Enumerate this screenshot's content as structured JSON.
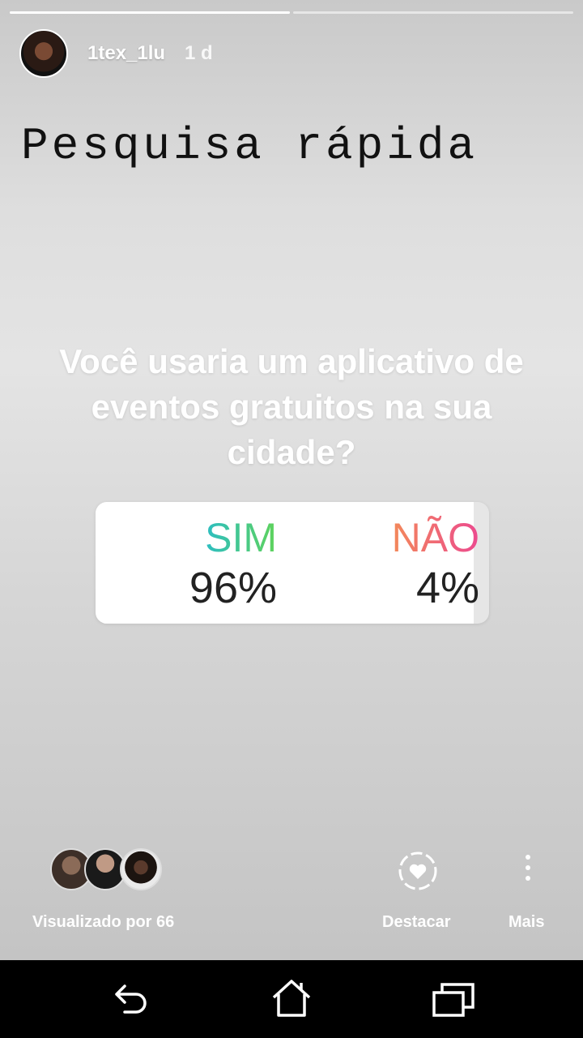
{
  "story": {
    "progress": [
      1.0,
      0.0
    ],
    "username": "1tex_1lu",
    "time_ago": "1 d",
    "headline": "Pesquisa rápida",
    "question": "Você usaria um aplicativo de eventos gratuitos na sua cidade?",
    "poll": {
      "yes_label": "SIM",
      "yes_percent": "96%",
      "no_label": "NÃO",
      "no_percent": "4%",
      "yes_fraction": 0.96
    }
  },
  "footer": {
    "viewed_by": "Visualizado por 66",
    "highlight_label": "Destacar",
    "more_label": "Mais"
  },
  "icons": {
    "highlight": "heart-circle-icon",
    "more": "vertical-dots-icon",
    "back": "back-icon",
    "home": "home-icon",
    "recent": "recent-apps-icon"
  },
  "colors": {
    "yes_gradient": [
      "#22b9d8",
      "#5fd35a"
    ],
    "no_gradient": [
      "#f3895a",
      "#ec4a8f"
    ]
  }
}
